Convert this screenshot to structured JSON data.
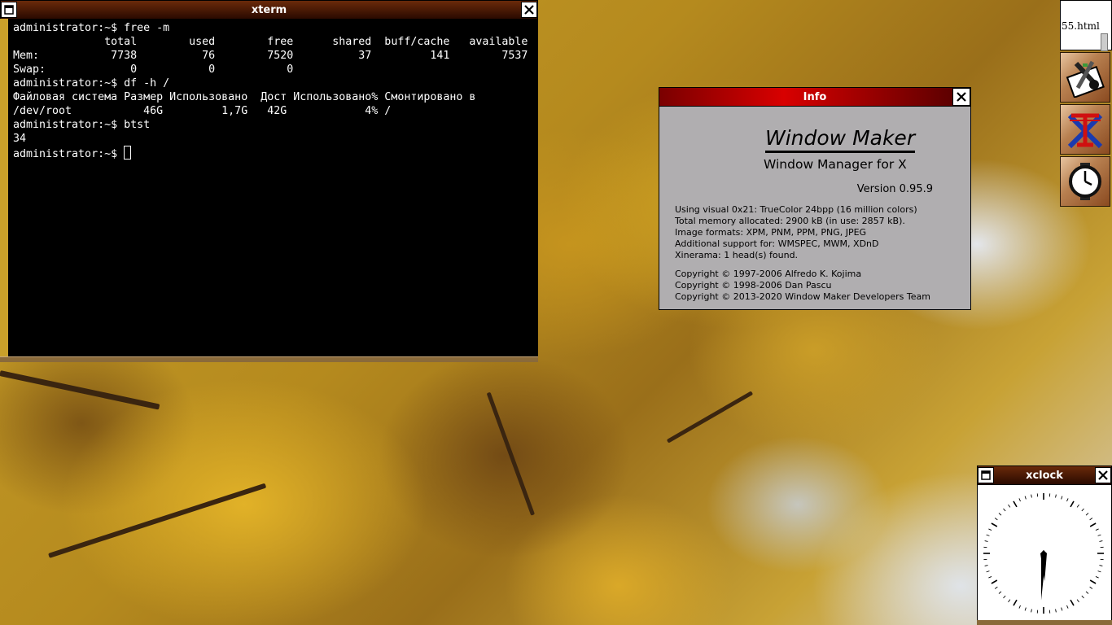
{
  "xterm": {
    "title": "xterm",
    "lines": [
      "administrator:~$ free -m",
      "              total        used        free      shared  buff/cache   available",
      "Mem:           7738          76        7520          37         141        7537",
      "Swap:             0           0           0",
      "administrator:~$ df -h /",
      "Файловая система Размер Использовано  Дост Использовано% Смонтировано в",
      "/dev/root           46G         1,7G   42G            4% /",
      "administrator:~$ btst",
      "34"
    ],
    "prompt": "administrator:~$ "
  },
  "info": {
    "title": "Info",
    "app_name": "Window Maker",
    "subtitle": "Window Manager for X",
    "version": "Version 0.95.9",
    "details": [
      "Using visual 0x21: TrueColor 24bpp (16 million colors)",
      "Total memory allocated: 2900 kB (in use: 2857 kB).",
      "Image formats: XPM, PNM, PPM, PNG, JPEG",
      "Additional support for: WMSPEC, MWM, XDnD",
      "Xinerama: 1 head(s) found."
    ],
    "copyright": [
      "Copyright © 1997-2006 Alfredo K. Kojima",
      "Copyright © 1998-2006 Dan Pascu",
      "Copyright © 2013-2020 Window Maker Developers Team"
    ]
  },
  "dock": {
    "browser_label": "55.html",
    "apps": [
      {
        "icon": "wmprefs-icon"
      },
      {
        "icon": "xterm-icon"
      },
      {
        "icon": "clock-icon"
      }
    ]
  },
  "xclock": {
    "title": "xclock"
  },
  "colors": {
    "titlebar_dark": "#2a0a00",
    "info_titlebar": "#d80000",
    "info_bg": "#b0aeb0",
    "terminal_bg": "#000000"
  }
}
